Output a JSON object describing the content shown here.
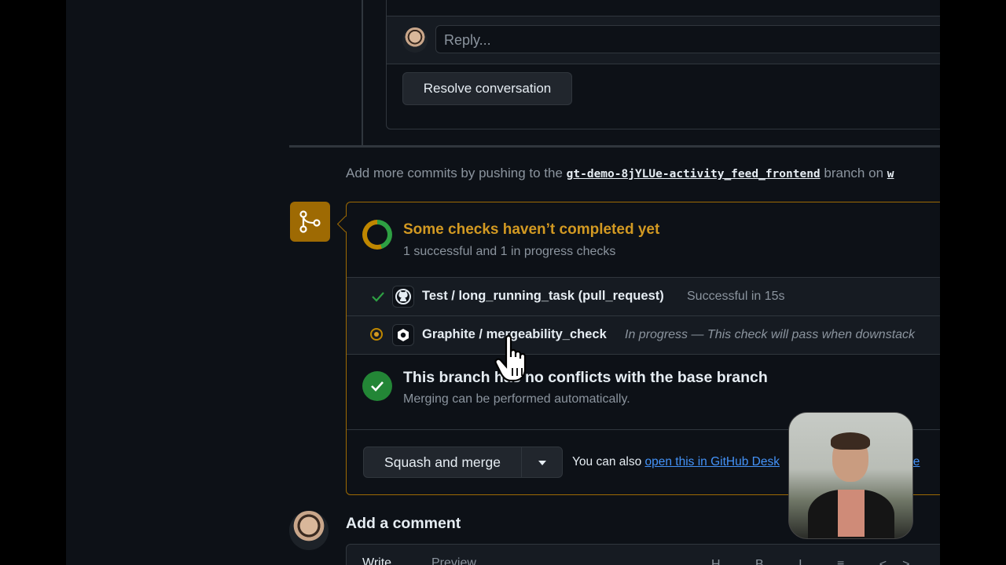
{
  "thread": {
    "reply_placeholder": "Reply...",
    "resolve_label": "Resolve conversation"
  },
  "push_note": {
    "prefix": "Add more commits by pushing to the",
    "branch": "gt-demo-8jYLUe-activity_feed_frontend",
    "suffix": "branch on",
    "repo_fragment": "w"
  },
  "checks": {
    "title": "Some checks haven’t completed yet",
    "summary": "1 successful and 1 in progress checks",
    "items": [
      {
        "name": "Test / long_running_task (pull_request)",
        "status": "Successful in 15s",
        "state": "success",
        "icon": "github-icon"
      },
      {
        "name": "Graphite / mergeability_check",
        "status": "In progress — This check will pass when downstack",
        "state": "pending",
        "icon": "graphite-icon"
      }
    ]
  },
  "conflicts": {
    "title": "This branch has no conflicts with the base branch",
    "subtitle": "Merging can be performed automatically."
  },
  "merge": {
    "button_label": "Squash and merge",
    "also_prefix": "You can also",
    "also_link": "open this in GitHub Desk",
    "also_link2": "line"
  },
  "comment": {
    "title": "Add a comment",
    "tab_write": "Write",
    "tab_preview": "Preview",
    "toolbar": "H B I ≡ <> ⛓ ⋮≡"
  },
  "colors": {
    "pending": "#d29922",
    "success": "#2ea043",
    "link": "#4493f8",
    "merge_icon_bg": "#9e6a03"
  }
}
